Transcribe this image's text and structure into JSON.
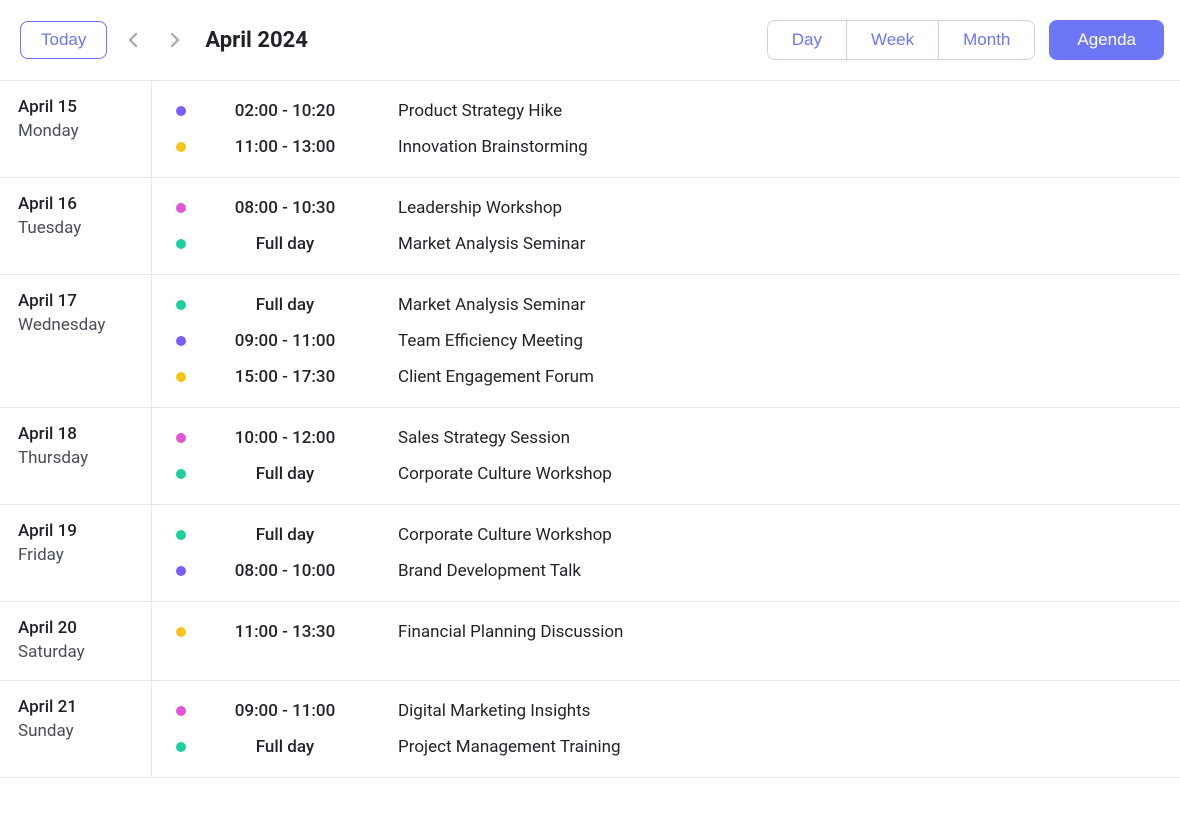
{
  "toolbar": {
    "today_label": "Today",
    "month_title": "April 2024",
    "views": {
      "day": "Day",
      "week": "Week",
      "month": "Month",
      "agenda": "Agenda"
    }
  },
  "colors": {
    "purple": "#7c5cfc",
    "yellow": "#f5c518",
    "magenta": "#e455d5",
    "teal": "#1ecfa0"
  },
  "agenda": [
    {
      "date": "April 15",
      "dow": "Monday",
      "events": [
        {
          "color": "purple",
          "time": "02:00 - 10:20",
          "title": "Product Strategy Hike"
        },
        {
          "color": "yellow",
          "time": "11:00 - 13:00",
          "title": "Innovation Brainstorming"
        }
      ]
    },
    {
      "date": "April 16",
      "dow": "Tuesday",
      "events": [
        {
          "color": "magenta",
          "time": "08:00 - 10:30",
          "title": "Leadership Workshop"
        },
        {
          "color": "teal",
          "time": "Full day",
          "title": "Market Analysis Seminar"
        }
      ]
    },
    {
      "date": "April 17",
      "dow": "Wednesday",
      "events": [
        {
          "color": "teal",
          "time": "Full day",
          "title": "Market Analysis Seminar"
        },
        {
          "color": "purple",
          "time": "09:00 - 11:00",
          "title": "Team Efficiency Meeting"
        },
        {
          "color": "yellow",
          "time": "15:00 - 17:30",
          "title": "Client Engagement Forum"
        }
      ]
    },
    {
      "date": "April 18",
      "dow": "Thursday",
      "events": [
        {
          "color": "magenta",
          "time": "10:00 - 12:00",
          "title": "Sales Strategy Session"
        },
        {
          "color": "teal",
          "time": "Full day",
          "title": "Corporate Culture Workshop"
        }
      ]
    },
    {
      "date": "April 19",
      "dow": "Friday",
      "events": [
        {
          "color": "teal",
          "time": "Full day",
          "title": "Corporate Culture Workshop"
        },
        {
          "color": "purple",
          "time": "08:00 - 10:00",
          "title": "Brand Development Talk"
        }
      ]
    },
    {
      "date": "April 20",
      "dow": "Saturday",
      "events": [
        {
          "color": "yellow",
          "time": "11:00 - 13:30",
          "title": "Financial Planning Discussion"
        }
      ]
    },
    {
      "date": "April 21",
      "dow": "Sunday",
      "events": [
        {
          "color": "magenta",
          "time": "09:00 - 11:00",
          "title": "Digital Marketing Insights"
        },
        {
          "color": "teal",
          "time": "Full day",
          "title": "Project Management Training"
        }
      ]
    }
  ]
}
